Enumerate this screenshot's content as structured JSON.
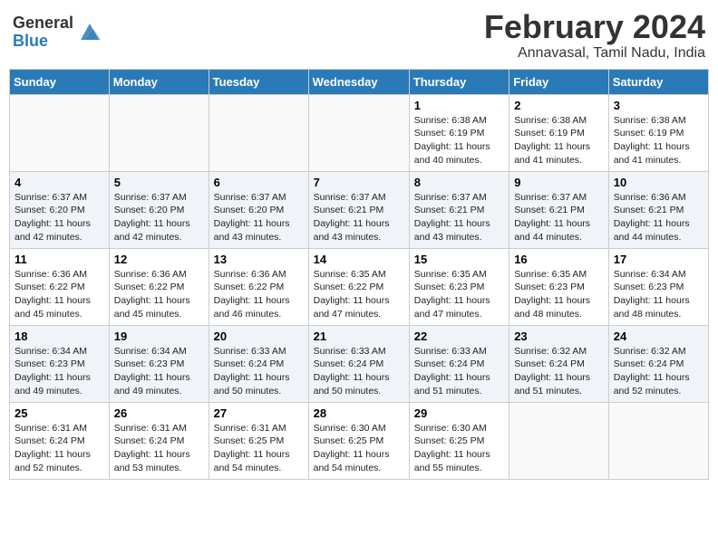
{
  "header": {
    "logo_general": "General",
    "logo_blue": "Blue",
    "title": "February 2024",
    "subtitle": "Annavasal, Tamil Nadu, India"
  },
  "days_of_week": [
    "Sunday",
    "Monday",
    "Tuesday",
    "Wednesday",
    "Thursday",
    "Friday",
    "Saturday"
  ],
  "weeks": [
    [
      {
        "day": "",
        "sunrise": "",
        "sunset": "",
        "daylight": ""
      },
      {
        "day": "",
        "sunrise": "",
        "sunset": "",
        "daylight": ""
      },
      {
        "day": "",
        "sunrise": "",
        "sunset": "",
        "daylight": ""
      },
      {
        "day": "",
        "sunrise": "",
        "sunset": "",
        "daylight": ""
      },
      {
        "day": "1",
        "sunrise": "Sunrise: 6:38 AM",
        "sunset": "Sunset: 6:19 PM",
        "daylight": "Daylight: 11 hours and 40 minutes."
      },
      {
        "day": "2",
        "sunrise": "Sunrise: 6:38 AM",
        "sunset": "Sunset: 6:19 PM",
        "daylight": "Daylight: 11 hours and 41 minutes."
      },
      {
        "day": "3",
        "sunrise": "Sunrise: 6:38 AM",
        "sunset": "Sunset: 6:19 PM",
        "daylight": "Daylight: 11 hours and 41 minutes."
      }
    ],
    [
      {
        "day": "4",
        "sunrise": "Sunrise: 6:37 AM",
        "sunset": "Sunset: 6:20 PM",
        "daylight": "Daylight: 11 hours and 42 minutes."
      },
      {
        "day": "5",
        "sunrise": "Sunrise: 6:37 AM",
        "sunset": "Sunset: 6:20 PM",
        "daylight": "Daylight: 11 hours and 42 minutes."
      },
      {
        "day": "6",
        "sunrise": "Sunrise: 6:37 AM",
        "sunset": "Sunset: 6:20 PM",
        "daylight": "Daylight: 11 hours and 43 minutes."
      },
      {
        "day": "7",
        "sunrise": "Sunrise: 6:37 AM",
        "sunset": "Sunset: 6:21 PM",
        "daylight": "Daylight: 11 hours and 43 minutes."
      },
      {
        "day": "8",
        "sunrise": "Sunrise: 6:37 AM",
        "sunset": "Sunset: 6:21 PM",
        "daylight": "Daylight: 11 hours and 43 minutes."
      },
      {
        "day": "9",
        "sunrise": "Sunrise: 6:37 AM",
        "sunset": "Sunset: 6:21 PM",
        "daylight": "Daylight: 11 hours and 44 minutes."
      },
      {
        "day": "10",
        "sunrise": "Sunrise: 6:36 AM",
        "sunset": "Sunset: 6:21 PM",
        "daylight": "Daylight: 11 hours and 44 minutes."
      }
    ],
    [
      {
        "day": "11",
        "sunrise": "Sunrise: 6:36 AM",
        "sunset": "Sunset: 6:22 PM",
        "daylight": "Daylight: 11 hours and 45 minutes."
      },
      {
        "day": "12",
        "sunrise": "Sunrise: 6:36 AM",
        "sunset": "Sunset: 6:22 PM",
        "daylight": "Daylight: 11 hours and 45 minutes."
      },
      {
        "day": "13",
        "sunrise": "Sunrise: 6:36 AM",
        "sunset": "Sunset: 6:22 PM",
        "daylight": "Daylight: 11 hours and 46 minutes."
      },
      {
        "day": "14",
        "sunrise": "Sunrise: 6:35 AM",
        "sunset": "Sunset: 6:22 PM",
        "daylight": "Daylight: 11 hours and 47 minutes."
      },
      {
        "day": "15",
        "sunrise": "Sunrise: 6:35 AM",
        "sunset": "Sunset: 6:23 PM",
        "daylight": "Daylight: 11 hours and 47 minutes."
      },
      {
        "day": "16",
        "sunrise": "Sunrise: 6:35 AM",
        "sunset": "Sunset: 6:23 PM",
        "daylight": "Daylight: 11 hours and 48 minutes."
      },
      {
        "day": "17",
        "sunrise": "Sunrise: 6:34 AM",
        "sunset": "Sunset: 6:23 PM",
        "daylight": "Daylight: 11 hours and 48 minutes."
      }
    ],
    [
      {
        "day": "18",
        "sunrise": "Sunrise: 6:34 AM",
        "sunset": "Sunset: 6:23 PM",
        "daylight": "Daylight: 11 hours and 49 minutes."
      },
      {
        "day": "19",
        "sunrise": "Sunrise: 6:34 AM",
        "sunset": "Sunset: 6:23 PM",
        "daylight": "Daylight: 11 hours and 49 minutes."
      },
      {
        "day": "20",
        "sunrise": "Sunrise: 6:33 AM",
        "sunset": "Sunset: 6:24 PM",
        "daylight": "Daylight: 11 hours and 50 minutes."
      },
      {
        "day": "21",
        "sunrise": "Sunrise: 6:33 AM",
        "sunset": "Sunset: 6:24 PM",
        "daylight": "Daylight: 11 hours and 50 minutes."
      },
      {
        "day": "22",
        "sunrise": "Sunrise: 6:33 AM",
        "sunset": "Sunset: 6:24 PM",
        "daylight": "Daylight: 11 hours and 51 minutes."
      },
      {
        "day": "23",
        "sunrise": "Sunrise: 6:32 AM",
        "sunset": "Sunset: 6:24 PM",
        "daylight": "Daylight: 11 hours and 51 minutes."
      },
      {
        "day": "24",
        "sunrise": "Sunrise: 6:32 AM",
        "sunset": "Sunset: 6:24 PM",
        "daylight": "Daylight: 11 hours and 52 minutes."
      }
    ],
    [
      {
        "day": "25",
        "sunrise": "Sunrise: 6:31 AM",
        "sunset": "Sunset: 6:24 PM",
        "daylight": "Daylight: 11 hours and 52 minutes."
      },
      {
        "day": "26",
        "sunrise": "Sunrise: 6:31 AM",
        "sunset": "Sunset: 6:24 PM",
        "daylight": "Daylight: 11 hours and 53 minutes."
      },
      {
        "day": "27",
        "sunrise": "Sunrise: 6:31 AM",
        "sunset": "Sunset: 6:25 PM",
        "daylight": "Daylight: 11 hours and 54 minutes."
      },
      {
        "day": "28",
        "sunrise": "Sunrise: 6:30 AM",
        "sunset": "Sunset: 6:25 PM",
        "daylight": "Daylight: 11 hours and 54 minutes."
      },
      {
        "day": "29",
        "sunrise": "Sunrise: 6:30 AM",
        "sunset": "Sunset: 6:25 PM",
        "daylight": "Daylight: 11 hours and 55 minutes."
      },
      {
        "day": "",
        "sunrise": "",
        "sunset": "",
        "daylight": ""
      },
      {
        "day": "",
        "sunrise": "",
        "sunset": "",
        "daylight": ""
      }
    ]
  ]
}
